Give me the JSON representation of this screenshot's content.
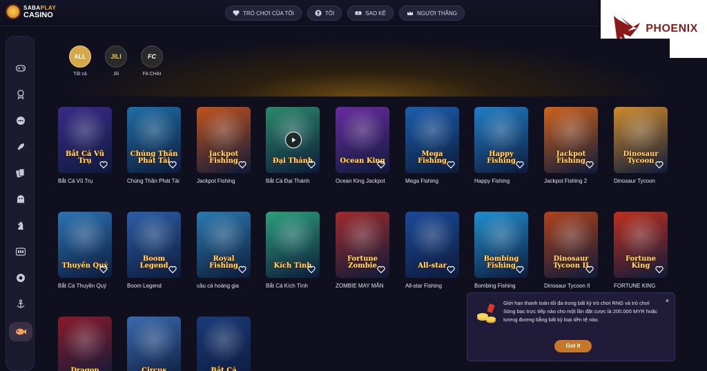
{
  "brand": {
    "top": "SABA",
    "top_accent": "PLAY",
    "bottom": "CASINO"
  },
  "nav": [
    {
      "label": "TRÒ CHƠI CỦA TÔI",
      "icon": "heart-game-icon"
    },
    {
      "label": "TÔI",
      "icon": "user-icon"
    },
    {
      "label": "SAO KÊ",
      "icon": "ticket-icon"
    },
    {
      "label": "NGƯỜI THẮNG",
      "icon": "crown-icon"
    }
  ],
  "watermark": {
    "text": "PHOENIX"
  },
  "sidebar": {
    "items": [
      {
        "icon": "gamepad-icon"
      },
      {
        "icon": "award-icon"
      },
      {
        "icon": "chat-bubble-icon"
      },
      {
        "icon": "rocket-icon"
      },
      {
        "icon": "cards-icon"
      },
      {
        "icon": "ghost-icon"
      },
      {
        "icon": "knight-icon"
      },
      {
        "icon": "slot-machine-icon"
      },
      {
        "icon": "ball-icon"
      },
      {
        "icon": "anchor-icon"
      },
      {
        "icon": "fish-icon"
      }
    ]
  },
  "filters": [
    {
      "badge": "ALL",
      "label": "Tất cả",
      "active": true
    },
    {
      "badge": "JILI",
      "label": "Jili",
      "active": false
    },
    {
      "badge": "FC",
      "label": "FA CHAI",
      "active": false
    }
  ],
  "games": [
    {
      "name": "Bắt Cá Vũ Trụ",
      "art": "Bắt Cá Vũ Trụ",
      "bg": "#3b2a8a"
    },
    {
      "name": "Chúng Thần Phát Tài",
      "art": "Chúng Thần Phát Tài",
      "bg": "#1d6fa8"
    },
    {
      "name": "Jackpot Fishing",
      "art": "Jackpot Fishing",
      "bg": "#c2521b"
    },
    {
      "name": "Bắt Cá Đại Thánh",
      "art": "Đại Thánh",
      "bg": "#2a8a6a"
    },
    {
      "name": "Ocean King Jackpot",
      "art": "Ocean King",
      "bg": "#6b2aa0"
    },
    {
      "name": "Mega Fishing",
      "art": "Mega Fishing",
      "bg": "#1a5fb0"
    },
    {
      "name": "Happy Fishing",
      "art": "Happy Fishing",
      "bg": "#1f7fc9"
    },
    {
      "name": "Jackpot Fishing 2",
      "art": "Jackpot Fishing",
      "bg": "#d0621a"
    },
    {
      "name": "Dinosaur Tycoon",
      "art": "Dinosaur Tycoon",
      "bg": "#d08a2a"
    },
    {
      "name": "Bắt Cá Thuyền Quý",
      "art": "Thuyền Quý",
      "bg": "#2c74b5"
    },
    {
      "name": "Boom Legend",
      "art": "Boom Legend",
      "bg": "#2b5fa8"
    },
    {
      "name": "câu cá hoàng gia",
      "art": "Royal Fishing",
      "bg": "#2a7ab0"
    },
    {
      "name": "Bắt Cá Kích Tình",
      "art": "Kích Tình",
      "bg": "#2aa07a"
    },
    {
      "name": "ZOMBIE MAY MẮN",
      "art": "Fortune Zombie",
      "bg": "#a02a2a"
    },
    {
      "name": "All-star Fishing",
      "art": "All-star",
      "bg": "#1a4a9a"
    },
    {
      "name": "Bombing Fishing",
      "art": "Bombing Fishing",
      "bg": "#1f8fd0"
    },
    {
      "name": "Dinosaur Tycoon II",
      "art": "Dinosaur Tycoon II",
      "bg": "#b0421a"
    },
    {
      "name": "FORTUNE KING",
      "art": "Fortune King",
      "bg": "#c0301e"
    },
    {
      "name": "",
      "art": "Dragon",
      "bg": "#8a1a2a"
    },
    {
      "name": "",
      "art": "Circus",
      "bg": "#3a6ab0"
    },
    {
      "name": "",
      "art": "Bắt Cá",
      "bg": "#1a3a7a"
    }
  ],
  "toast": {
    "message": "Giới hạn thanh toán tối đa trong bất kỳ trò chơi RNG và trò chơi Sòng bạc trực tiếp nào cho một lần đặt cược là 200.000 MYR hoặc tương đương bằng bất kỳ loại tiền tệ nào.",
    "button": "Got it",
    "close": "×"
  }
}
